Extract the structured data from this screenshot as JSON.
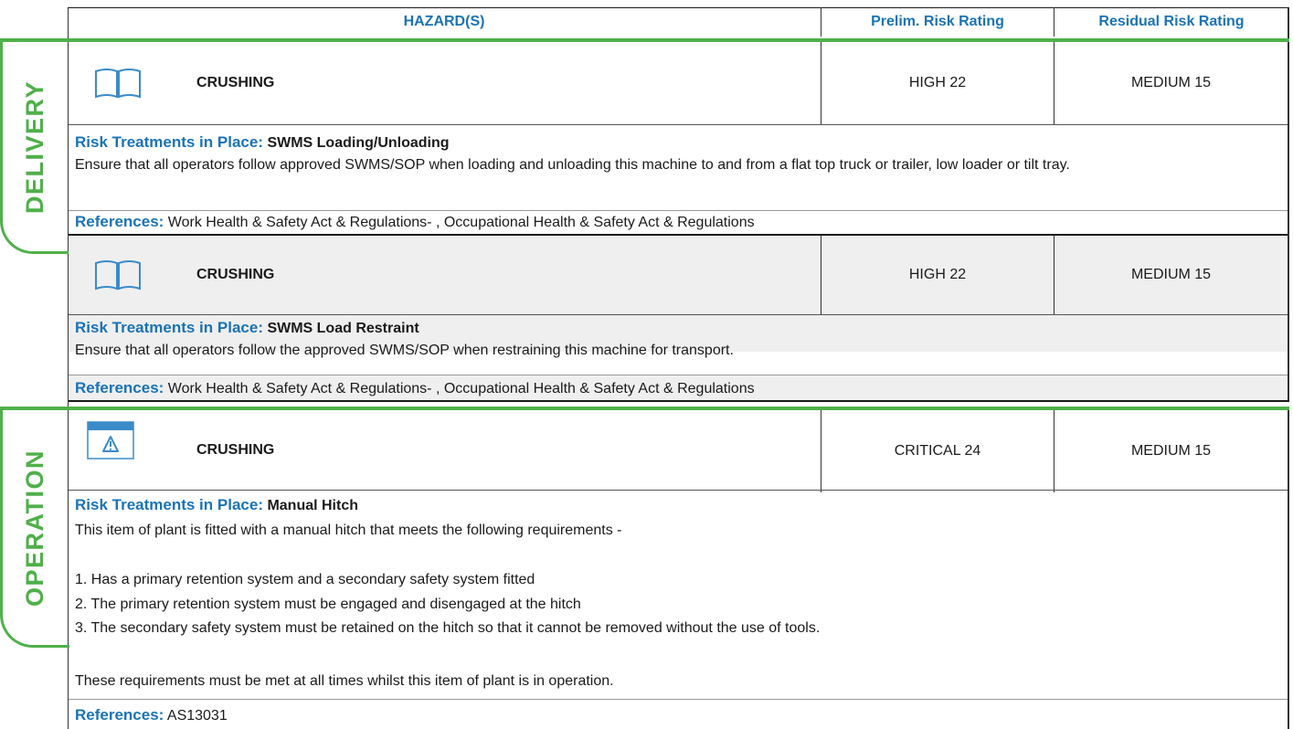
{
  "header": {
    "hazards": "HAZARD(S)",
    "prelim": "Prelim. Risk Rating",
    "residual": "Residual Risk Rating"
  },
  "sections": [
    {
      "label": "DELIVERY",
      "entries": [
        {
          "icon": "book-icon",
          "hazard": "CRUSHING",
          "prelim": "HIGH 22",
          "residual": "MEDIUM 15",
          "treatment_label": "Risk Treatments in Place:",
          "treatment_title": "SWMS Loading/Unloading",
          "treatment_text": "Ensure that all operators follow approved SWMS/SOP when loading and unloading this machine to and from a flat top truck or trailer, low loader or tilt tray.",
          "references_label": "References:",
          "references": "Work Health & Safety Act & Regulations- , Occupational Health & Safety Act & Regulations"
        },
        {
          "icon": "book-icon",
          "hazard": "CRUSHING",
          "prelim": "HIGH 22",
          "residual": "MEDIUM 15",
          "treatment_label": "Risk Treatments in Place:",
          "treatment_title": "SWMS Load Restraint",
          "treatment_text": "Ensure that all operators follow the approved SWMS/SOP when restraining this machine for transport.",
          "references_label": "References:",
          "references": "Work Health & Safety Act & Regulations- , Occupational Health & Safety Act & Regulations"
        }
      ]
    },
    {
      "label": "OPERATION",
      "entries": [
        {
          "icon": "warning-window-icon",
          "hazard": "CRUSHING",
          "prelim": "CRITICAL 24",
          "residual": "MEDIUM 15",
          "treatment_label": "Risk Treatments in Place:",
          "treatment_title": "Manual Hitch",
          "treatment_lines": [
            "This item of plant is fitted with a manual hitch that meets the following requirements -",
            "1. Has a primary retention system and a secondary safety system fitted",
            "2. The primary retention system must be engaged and disengaged at the hitch",
            "3. The secondary safety system must be retained on the hitch so that it cannot be removed without the use of tools.",
            "These requirements must be met at all times whilst this item of plant is in operation."
          ],
          "references_label": "References:",
          "references": "AS13031"
        }
      ]
    }
  ],
  "colors": {
    "accent_blue": "#1a73b5",
    "section_green": "#4fb04a",
    "row_shade": "#efefef"
  }
}
